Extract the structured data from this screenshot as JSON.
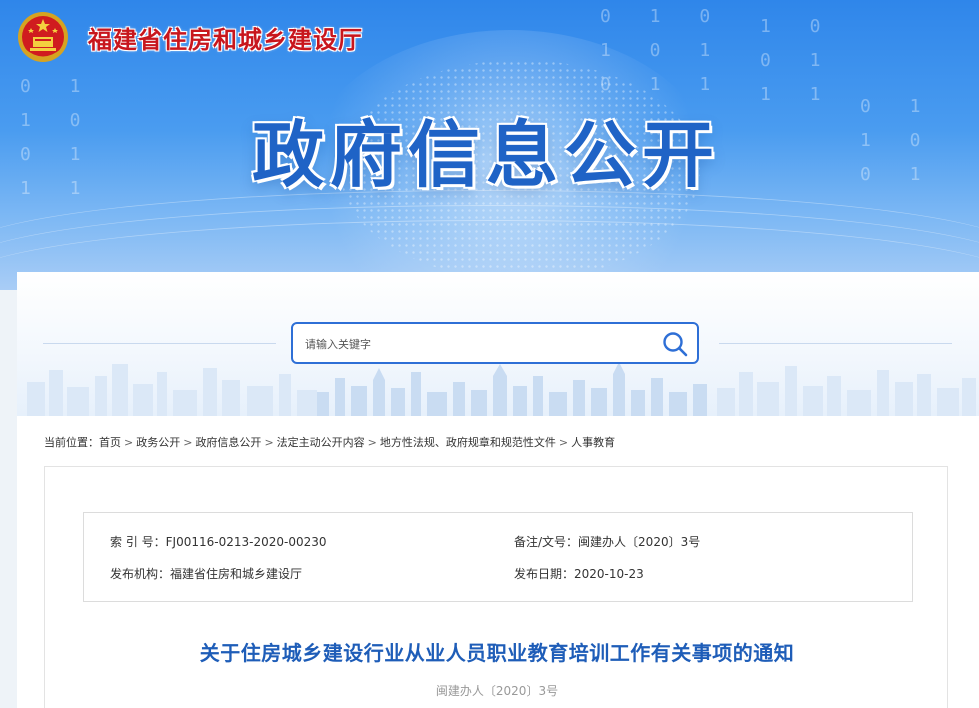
{
  "site": {
    "name": "福建省住房和城乡建设厅",
    "banner_title": "政府信息公开"
  },
  "search": {
    "placeholder": "请输入关键字",
    "value": ""
  },
  "breadcrumb": {
    "prefix": "当前位置：",
    "items": [
      "首页",
      "政务公开",
      "政府信息公开",
      "法定主动公开内容",
      "地方性法规、政府规章和规范性文件",
      "人事教育"
    ],
    "separator": ">"
  },
  "meta": {
    "index_label": "索 引 号：",
    "index_value": "FJ00116-0213-2020-00230",
    "docno_label": "备注/文号：",
    "docno_value": "闽建办人〔2020〕3号",
    "org_label": "发布机构：",
    "org_value": "福建省住房和城乡建设厅",
    "date_label": "发布日期：",
    "date_value": "2020-10-23"
  },
  "document": {
    "title": "关于住房城乡建设行业从业人员职业教育培训工作有关事项的通知",
    "number": "闽建办人〔2020〕3号"
  },
  "colors": {
    "site_name": "#c8161d",
    "banner_title": "#1f63c6",
    "doc_title": "#1e5db8",
    "search_border": "#2e6fd6"
  },
  "icons": {
    "emblem": "national-emblem-icon",
    "search": "search-icon"
  }
}
